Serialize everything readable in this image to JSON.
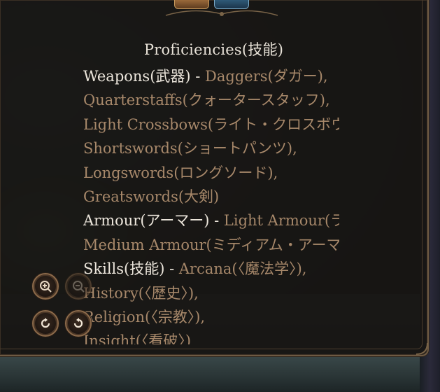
{
  "panel": {
    "title": "Proficiencies(技能)",
    "lines": [
      {
        "label": "Weapons(武器)",
        "sep": " - ",
        "value": "Daggers(ダガー), "
      },
      {
        "value": "Quarterstaffs(クォータースタッフ), "
      },
      {
        "value": "Light Crossbows(ライト・クロスボウ), "
      },
      {
        "value": "Shortswords(ショートパンツ),"
      },
      {
        "value": "Longswords(ロングソード),"
      },
      {
        "value": "Greatswords(大剣)"
      },
      {
        "label": "Armour(アーマー)",
        "sep": " - ",
        "value": "Light Armour(ライト・アーマー), "
      },
      {
        "value": "Medium Armour(ミディアム・アーマー)"
      },
      {
        "label": "Skills(技能)",
        "sep": " - ",
        "value": "Arcana(〈魔法学〉),"
      },
      {
        "value": "History(〈歴史〉),"
      },
      {
        "value": "Religion(〈宗教〉),"
      },
      {
        "value": "Insight(〈看破〉)"
      }
    ]
  },
  "controls": {
    "zoom_in_icon": "zoom-in-icon",
    "zoom_out_icon": "zoom-out-icon",
    "rotate_right_icon": "rotate-clockwise-icon",
    "rotate_left_icon": "rotate-counterclockwise-icon"
  },
  "colors": {
    "heading_text": "#ece6dc",
    "value_text": "#a7886a",
    "panel_border": "#6e5a43"
  }
}
